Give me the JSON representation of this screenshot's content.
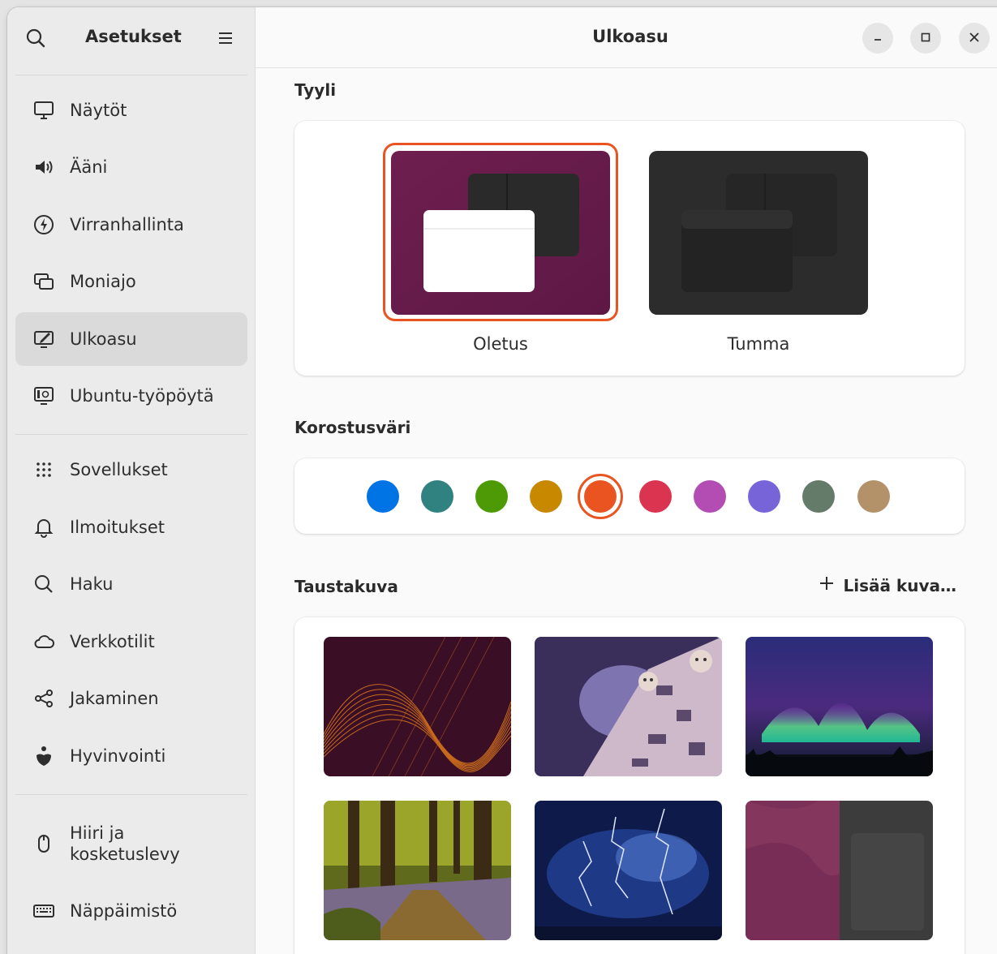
{
  "sidebar": {
    "title": "Asetukset",
    "items": [
      {
        "label": "Näytöt",
        "icon": "display-icon"
      },
      {
        "label": "Ääni",
        "icon": "speaker-icon"
      },
      {
        "label": "Virranhallinta",
        "icon": "power-icon"
      },
      {
        "label": "Moniajo",
        "icon": "multitasking-icon"
      },
      {
        "label": "Ulkoasu",
        "icon": "appearance-icon",
        "active": true
      },
      {
        "label": "Ubuntu-työpöytä",
        "icon": "ubuntu-desktop-icon"
      },
      {
        "label": "Sovellukset",
        "icon": "apps-grid-icon"
      },
      {
        "label": "Ilmoitukset",
        "icon": "bell-icon"
      },
      {
        "label": "Haku",
        "icon": "search-icon"
      },
      {
        "label": "Verkkotilit",
        "icon": "cloud-icon"
      },
      {
        "label": "Jakaminen",
        "icon": "share-icon"
      },
      {
        "label": "Hyvinvointi",
        "icon": "wellbeing-icon"
      },
      {
        "label": "Hiiri ja kosketuslevy",
        "icon": "mouse-icon"
      },
      {
        "label": "Näppäimistö",
        "icon": "keyboard-icon"
      }
    ]
  },
  "header": {
    "title": "Ulkoasu"
  },
  "style_section": {
    "title": "Tyyli",
    "options": [
      {
        "label": "Oletus",
        "selected": true
      },
      {
        "label": "Tumma",
        "selected": false
      }
    ]
  },
  "accent_section": {
    "title": "Korostusväri",
    "colors": [
      "#0073e5",
      "#308280",
      "#4e9a06",
      "#c88800",
      "#e95420",
      "#da3450",
      "#b34cb3",
      "#7764d8",
      "#657b69",
      "#b39169"
    ],
    "selected_index": 4
  },
  "wallpaper_section": {
    "title": "Taustakuva",
    "add_label": "Lisää kuva…",
    "thumbnails": [
      "wave-wallpaper",
      "raccoon-illustration-wallpaper",
      "aurora-wallpaper",
      "forest-path-wallpaper",
      "lightning-storm-wallpaper",
      "split-purple-dark-wallpaper"
    ]
  }
}
